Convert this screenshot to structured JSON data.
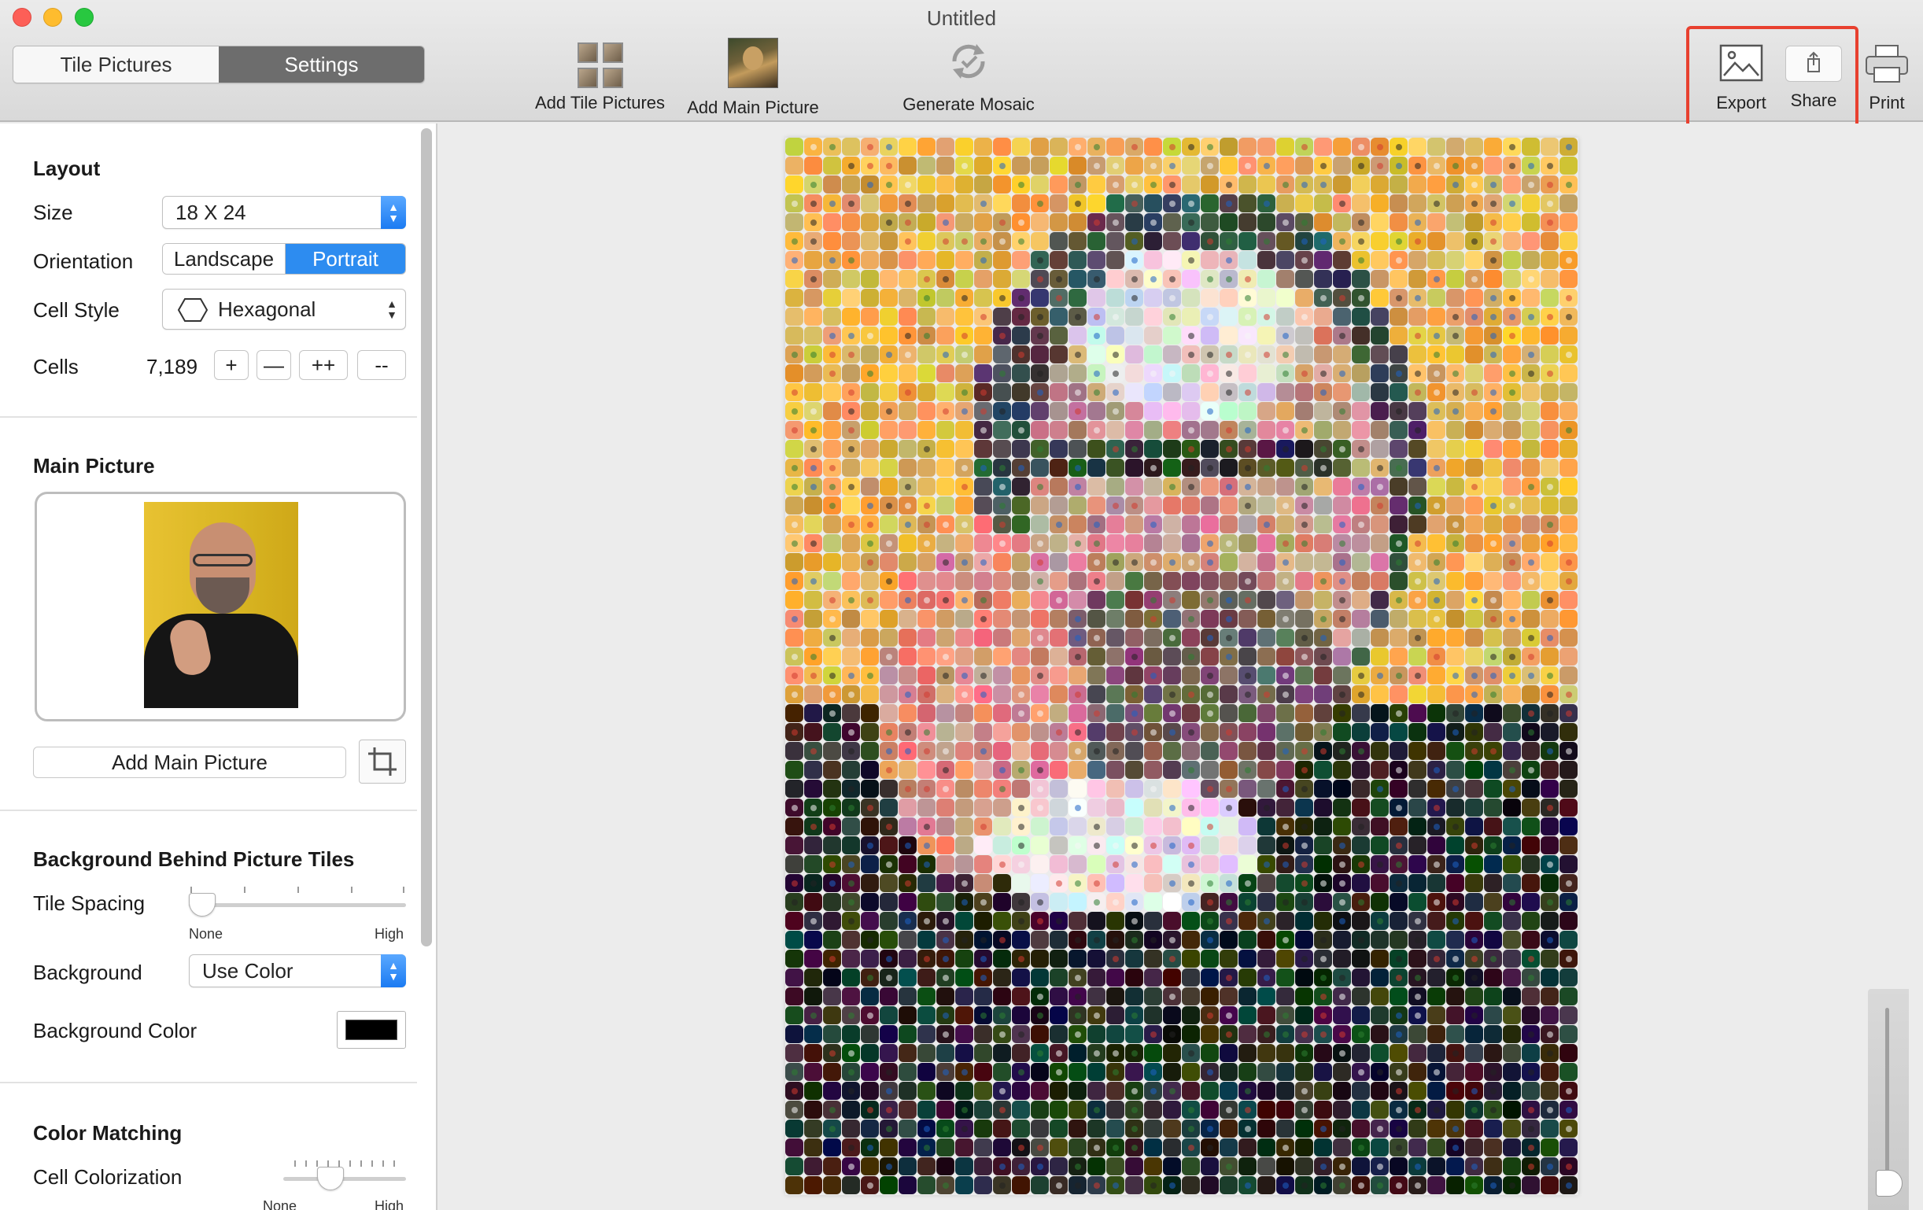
{
  "window": {
    "title": "Untitled"
  },
  "tabs": [
    {
      "label": "Tile Pictures",
      "selected": false
    },
    {
      "label": "Settings",
      "selected": true
    }
  ],
  "toolbar": {
    "add_tile_pictures": "Add Tile Pictures",
    "add_main_picture": "Add Main Picture",
    "generate_mosaic": "Generate Mosaic",
    "export": "Export",
    "share": "Share",
    "print": "Print",
    "highlight_color": "#e8402f"
  },
  "layout": {
    "heading": "Layout",
    "size_label": "Size",
    "size_value": "18 X 24",
    "orientation_label": "Orientation",
    "orientation_options": [
      "Landscape",
      "Portrait"
    ],
    "orientation_selected": "Portrait",
    "cell_style_label": "Cell Style",
    "cell_style_value": "Hexagonal",
    "cells_label": "Cells",
    "cells_value": "7,189",
    "cells_buttons": [
      "+",
      "—",
      "++",
      "--"
    ]
  },
  "main_picture": {
    "heading": "Main Picture",
    "add_button": "Add Main Picture",
    "crop_icon": "crop-icon"
  },
  "background": {
    "heading": "Background Behind Picture Tiles",
    "tile_spacing_label": "Tile Spacing",
    "tile_spacing_min": "None",
    "tile_spacing_max": "High",
    "tile_spacing_level": 0,
    "background_label": "Background",
    "background_value": "Use Color",
    "background_color_label": "Background Color",
    "background_color": "#000000"
  },
  "color_matching": {
    "heading": "Color Matching",
    "cell_colorization_label": "Cell Colorization",
    "cell_colorization_level": 0.35,
    "min": "None",
    "max": "High"
  },
  "colors": {
    "accent": "#2d8cf0",
    "selected_tab": "#6d6d6d"
  }
}
